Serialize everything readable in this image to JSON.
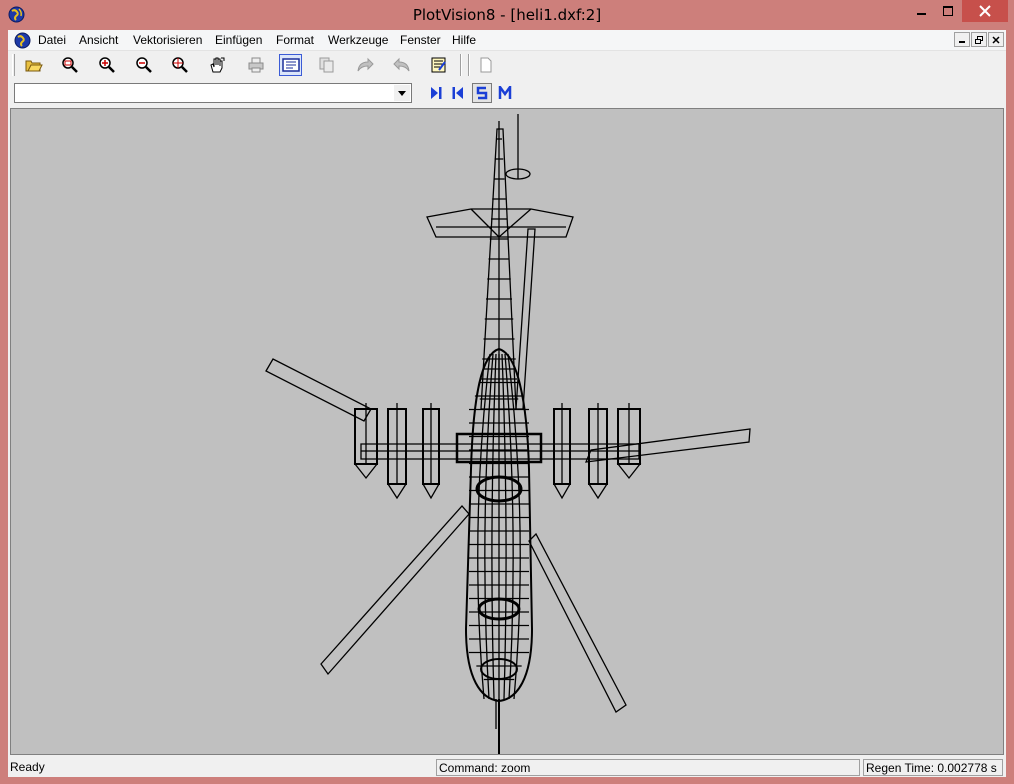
{
  "window": {
    "title": "PlotVision8 - [heli1.dxf:2]",
    "frame_color": "#cd7f7b",
    "close_color": "#c7504b"
  },
  "icons": {
    "app": "globe-icon",
    "minimize": "minimize-icon",
    "maximize": "maximize-icon",
    "close": "close-icon"
  },
  "menu": {
    "items": [
      "Datei",
      "Ansicht",
      "Vektorisieren",
      "Einfügen",
      "Format",
      "Werkzeuge",
      "Fenster",
      "Hilfe"
    ]
  },
  "toolbar": {
    "buttons": [
      "open-folder-icon",
      "zoom-window-icon",
      "zoom-in-icon",
      "zoom-out-icon",
      "zoom-extents-icon",
      "pan-icon",
      "print-icon",
      "print-preview-icon",
      "copy-icon",
      "redo-icon",
      "undo-icon",
      "properties-icon",
      "new-page-icon"
    ]
  },
  "toolbar2": {
    "combo_value": "",
    "nav_buttons": [
      "last-layout-icon",
      "first-layout-icon",
      "model-space-icon",
      "paper-space-icon"
    ]
  },
  "status": {
    "ready": "Ready",
    "command": "Command: zoom",
    "regen": "Regen Time: 0.002778 s"
  },
  "drawing": {
    "file": "heli1.dxf",
    "background": "#c0c0c0",
    "line_color": "#000000"
  }
}
